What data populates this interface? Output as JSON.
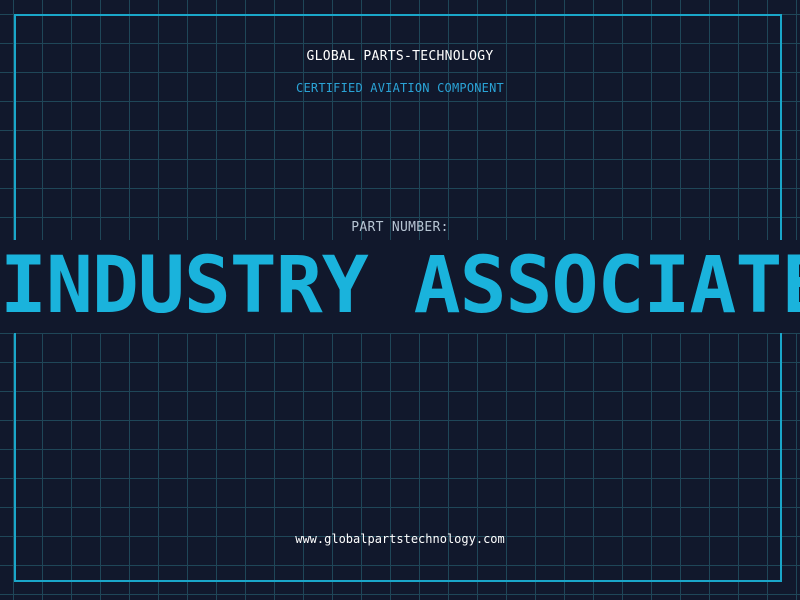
{
  "header": {
    "brand": "GLOBAL PARTS-TECHNOLOGY",
    "subtitle": "CERTIFIED AVIATION COMPONENT"
  },
  "part": {
    "label": "PART NUMBER:",
    "value": "INDUSTRY ASSOCIATE"
  },
  "footer": {
    "url": "www.globalpartstechnology.com"
  },
  "colors": {
    "background": "#11182c",
    "grid": "#1f4658",
    "frame": "#1aa6c9",
    "accent": "#1ab3dc",
    "subtitle": "#2aa3d6",
    "label": "#b7c5d3",
    "text": "#ffffff"
  }
}
